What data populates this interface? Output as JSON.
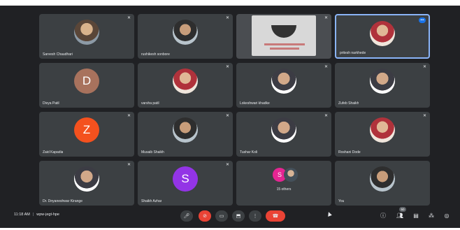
{
  "tiles": [
    {
      "name": "Sarvesh Chaudhari",
      "avatar": "photo",
      "muted": true
    },
    {
      "name": "rushikesh sonbore",
      "avatar": "photo",
      "muted": true
    },
    {
      "name": "",
      "avatar": "screen-share",
      "muted": true
    },
    {
      "name": "pritesh narkhede",
      "avatar": "photo",
      "active": true,
      "talking_badge": "•••"
    },
    {
      "name": "Divya Patil",
      "avatar_letter": "D",
      "avatar_color": "#a8725d",
      "muted": false
    },
    {
      "name": "varsha patil",
      "avatar": "photo",
      "muted": true
    },
    {
      "name": "Lokeshwari khadke",
      "avatar": "photo",
      "muted": true
    },
    {
      "name": "Zufeb Shaikh",
      "avatar": "photo",
      "muted": true
    },
    {
      "name": "Zaid Kapadia",
      "avatar_letter": "Z",
      "avatar_color": "#f4511e",
      "muted": true
    },
    {
      "name": "Musaib Shaikh",
      "avatar": "photo",
      "muted": true
    },
    {
      "name": "Tushar Koli",
      "avatar": "photo",
      "muted": true
    },
    {
      "name": "Roshani Dode",
      "avatar": "photo",
      "muted": true
    },
    {
      "name": "Dr. Dnyaneshwar Kirange",
      "avatar": "photo",
      "muted": true
    },
    {
      "name": "Shaikh Azhar",
      "avatar_letter": "S",
      "avatar_color": "#9334e6",
      "muted": true
    },
    {
      "name": "15 others",
      "avatar": "others",
      "mini_letter": "S"
    },
    {
      "name": "You",
      "avatar": "photo",
      "muted": false
    }
  ],
  "bottom_bar": {
    "time": "11:18 AM",
    "separator": "|",
    "meeting_code": "wpw-jegt-hpe",
    "people_count": "50"
  },
  "colors": {
    "background": "#202124",
    "tile": "#3c4043",
    "active_border": "#8ab4f8",
    "end_call": "#ea4335"
  },
  "icons": {
    "mic": "mic-icon",
    "camera_off": "camera-off-icon",
    "captions": "captions-icon",
    "present": "present-icon",
    "more": "more-options-icon",
    "end_call": "end-call-icon",
    "info": "info-icon",
    "people": "people-icon",
    "chat": "chat-icon",
    "activities": "activities-icon",
    "host_controls": "host-controls-icon"
  }
}
